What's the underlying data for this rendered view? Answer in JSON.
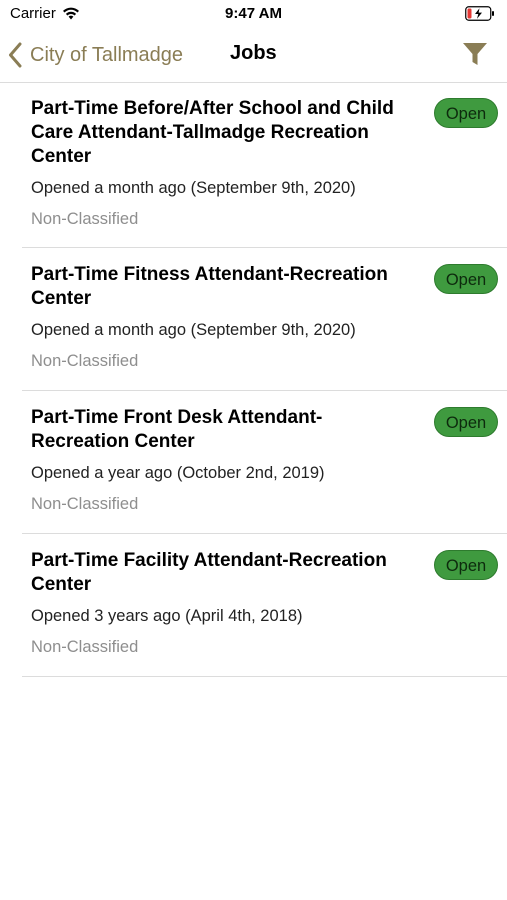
{
  "status_bar": {
    "carrier": "Carrier",
    "time": "9:47 AM",
    "icons": [
      "wifi-icon",
      "battery-charging-icon"
    ]
  },
  "nav": {
    "back_label": "City of Tallmadge",
    "title": "Jobs",
    "back_icon": "chevron-left-icon",
    "filter_icon": "filter-icon",
    "accent_color": "#8a7d55"
  },
  "jobs": [
    {
      "title": "Part-Time Before/After School and Child Care Attendant-Tallmadge Recreation Center",
      "opened": "Opened a month ago (September 9th, 2020)",
      "classification": "Non-Classified",
      "status": "Open"
    },
    {
      "title": "Part-Time Fitness Attendant-Recreation Center",
      "opened": "Opened a month ago (September 9th, 2020)",
      "classification": "Non-Classified",
      "status": "Open"
    },
    {
      "title": "Part-Time Front Desk Attendant-Recreation Center",
      "opened": "Opened a year ago (October 2nd, 2019)",
      "classification": "Non-Classified",
      "status": "Open"
    },
    {
      "title": "Part-Time Facility Attendant-Recreation Center",
      "opened": "Opened 3 years ago (April 4th, 2018)",
      "classification": "Non-Classified",
      "status": "Open"
    }
  ],
  "colors": {
    "status_open": "#3f9a3f",
    "secondary_text": "#8e8e8e"
  }
}
